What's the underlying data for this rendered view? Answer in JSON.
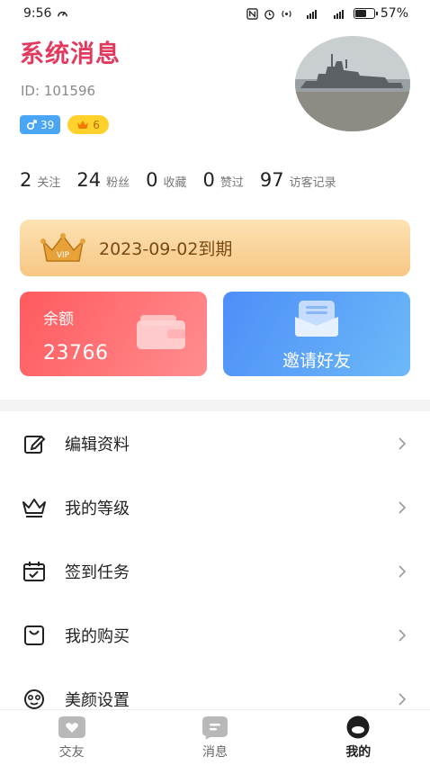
{
  "status_bar": {
    "time": "9:56",
    "battery": "57%",
    "signal_1": "2",
    "signal_2": "46"
  },
  "profile": {
    "name": "系统消息",
    "id_text": "ID: 101596",
    "gender_badge": "39",
    "level_badge": "6",
    "avatar_icon": "avatar-photo-ship"
  },
  "stats": [
    {
      "num": "2",
      "label": "关注"
    },
    {
      "num": "24",
      "label": "粉丝"
    },
    {
      "num": "0",
      "label": "收藏"
    },
    {
      "num": "0",
      "label": "赞过"
    },
    {
      "num": "97",
      "label": "访客记录"
    }
  ],
  "vip": {
    "crown_text": "VIP",
    "expiry": "2023-09-02到期"
  },
  "cards": {
    "balance_label": "余额",
    "balance_value": "23766",
    "invite_label": "邀请好友"
  },
  "menu": [
    {
      "label": "编辑资料",
      "icon": "edit-icon"
    },
    {
      "label": "我的等级",
      "icon": "crown-icon"
    },
    {
      "label": "签到任务",
      "icon": "calendar-check-icon"
    },
    {
      "label": "我的购买",
      "icon": "bag-icon"
    },
    {
      "label": "美颜设置",
      "icon": "face-icon"
    }
  ],
  "bottom_nav": [
    {
      "label": "交友",
      "icon": "heart-icon"
    },
    {
      "label": "消息",
      "icon": "chat-icon"
    },
    {
      "label": "我的",
      "icon": "profile-icon"
    }
  ],
  "colors": {
    "name": "#e23a5f",
    "balance_card": "#ff5a5e",
    "invite_card": "#4d8ef8",
    "vip_banner": "#f7c784"
  }
}
